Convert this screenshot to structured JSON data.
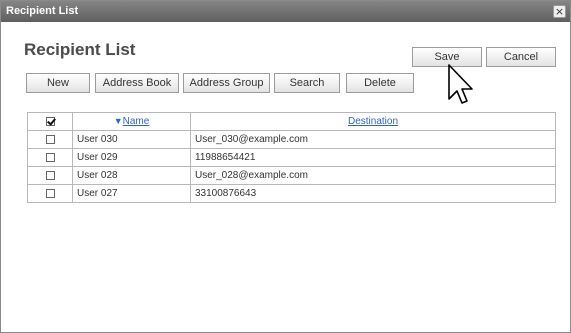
{
  "window": {
    "title": "Recipient List",
    "close_label": "×"
  },
  "page": {
    "heading": "Recipient List"
  },
  "actions": {
    "save_label": "Save",
    "cancel_label": "Cancel"
  },
  "toolbar": {
    "new_label": "New",
    "address_book_label": "Address Book",
    "address_group_label": "Address Group",
    "search_label": "Search",
    "delete_label": "Delete"
  },
  "table": {
    "sort_arrow": "▼",
    "headers": {
      "name": "Name",
      "destination": "Destination"
    },
    "select_all_checked": true,
    "rows": [
      {
        "name": "User 030",
        "destination": "User_030@example.com",
        "checked": false
      },
      {
        "name": "User 029",
        "destination": "11988654421",
        "checked": false
      },
      {
        "name": "User 028",
        "destination": "User_028@example.com",
        "checked": false
      },
      {
        "name": "User 027",
        "destination": "33100876643",
        "checked": false
      }
    ]
  }
}
